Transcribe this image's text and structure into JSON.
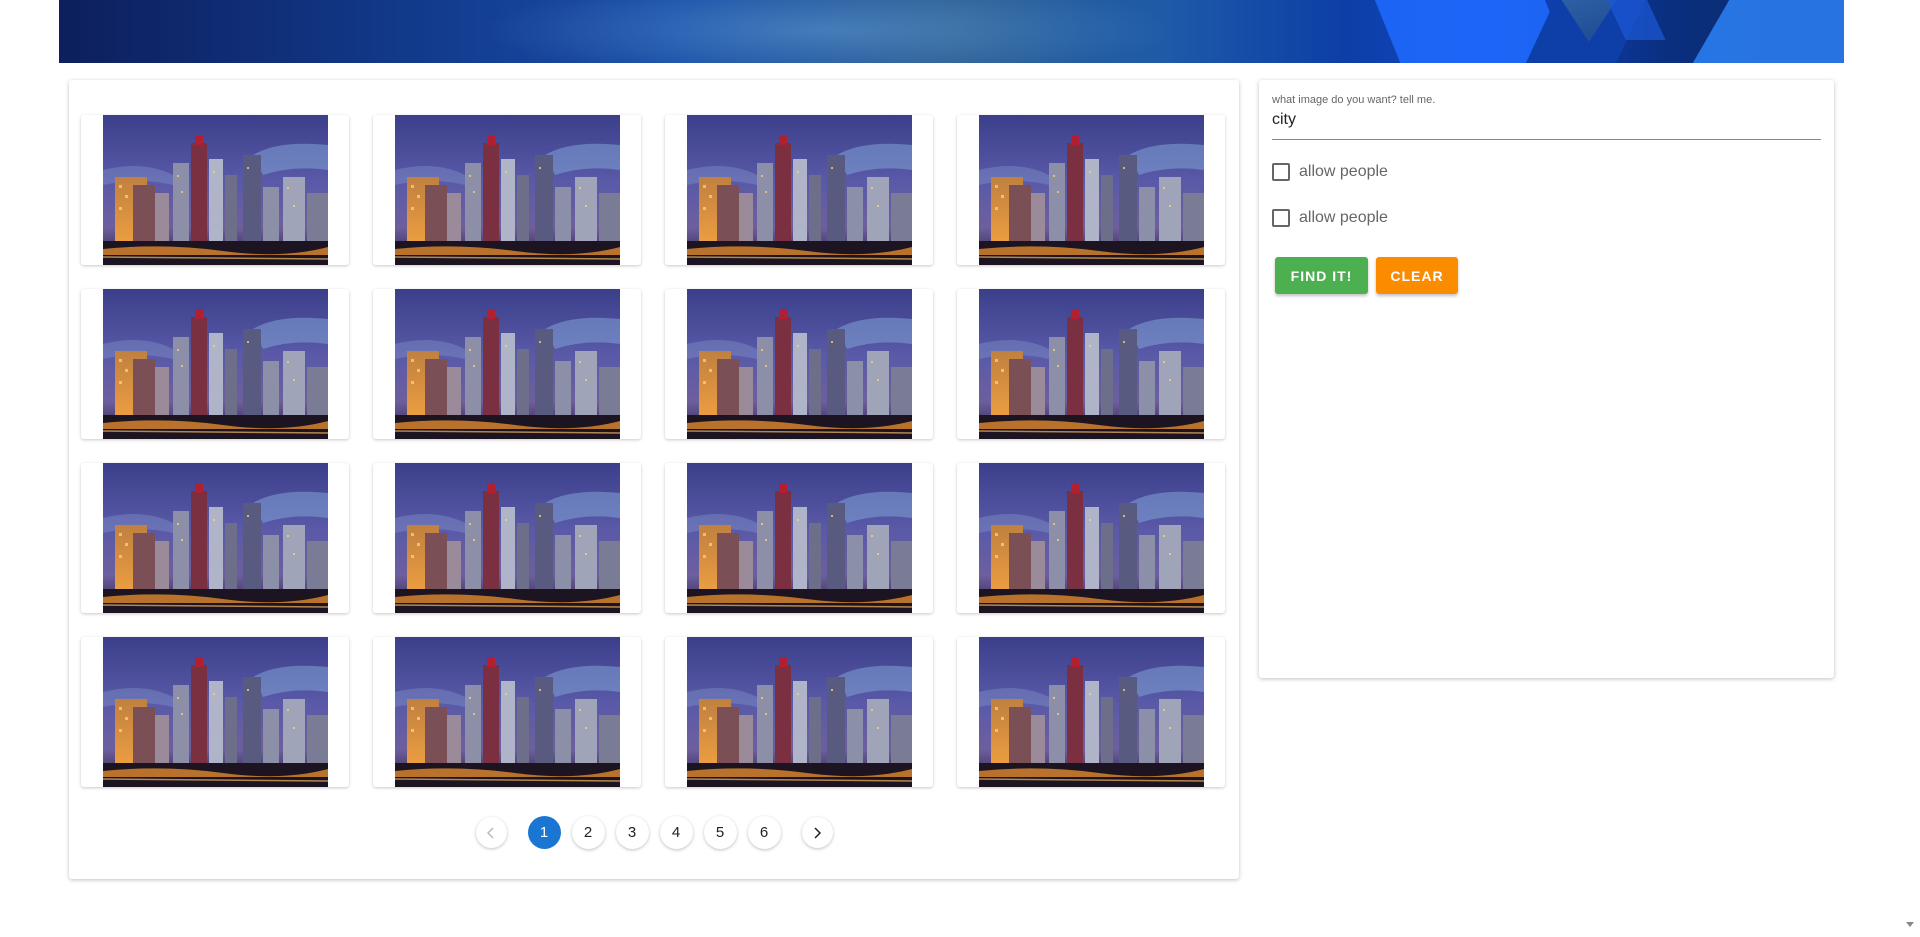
{
  "search": {
    "label": "what image do you want? tell me.",
    "value": "city",
    "checkboxes": [
      {
        "label": "allow people",
        "checked": false
      },
      {
        "label": "allow people",
        "checked": false
      }
    ],
    "find_label": "FIND IT!",
    "clear_label": "CLEAR"
  },
  "results": {
    "image_count": 16
  },
  "pagination": {
    "pages": [
      "1",
      "2",
      "3",
      "4",
      "5",
      "6"
    ],
    "current": "1"
  },
  "colors": {
    "accent_blue": "#1976d2",
    "find_button": "#4caf50",
    "clear_button": "#fb8c00"
  },
  "icons": {
    "prev": "chevron-left-icon",
    "next": "chevron-right-icon",
    "checkbox": "checkbox-unchecked-icon"
  }
}
